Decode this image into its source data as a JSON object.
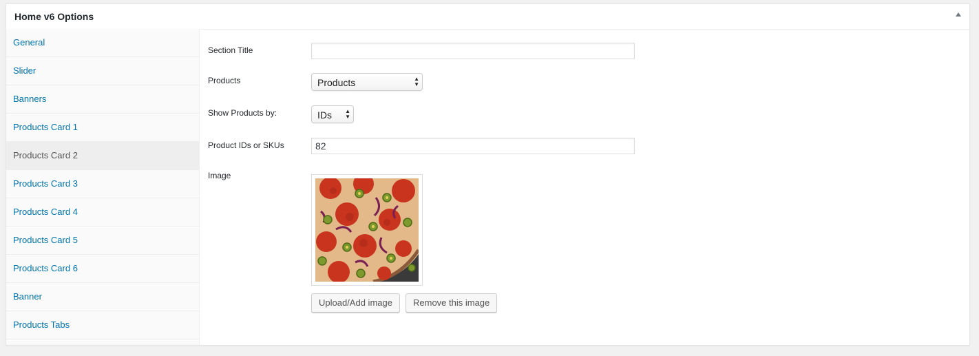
{
  "box": {
    "title": "Home v6 Options",
    "toggle_icon": "arrow-up-icon"
  },
  "tabs": [
    {
      "label": "General",
      "active": false
    },
    {
      "label": "Slider",
      "active": false
    },
    {
      "label": "Banners",
      "active": false
    },
    {
      "label": "Products Card 1",
      "active": false
    },
    {
      "label": "Products Card 2",
      "active": true
    },
    {
      "label": "Products Card 3",
      "active": false
    },
    {
      "label": "Products Card 4",
      "active": false
    },
    {
      "label": "Products Card 5",
      "active": false
    },
    {
      "label": "Products Card 6",
      "active": false
    },
    {
      "label": "Banner",
      "active": false
    },
    {
      "label": "Products Tabs",
      "active": false
    }
  ],
  "form": {
    "section_title": {
      "label": "Section Title",
      "value": ""
    },
    "products": {
      "label": "Products",
      "selected": "Products"
    },
    "show_by": {
      "label": "Show Products by:",
      "selected": "IDs"
    },
    "ids": {
      "label": "Product IDs or SKUs",
      "value": "82"
    },
    "image": {
      "label": "Image",
      "upload_label": "Upload/Add image",
      "remove_label": "Remove this image"
    }
  },
  "colors": {
    "link": "#0073aa",
    "active_tab_bg": "#eeeeee",
    "page_bg": "#f1f1f1"
  }
}
